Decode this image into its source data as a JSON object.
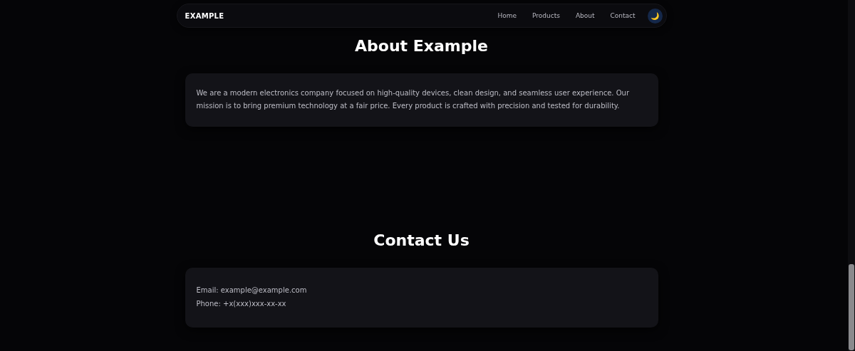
{
  "navbar": {
    "brand": "EXAMPLE",
    "links": [
      {
        "label": "Home"
      },
      {
        "label": "Products"
      },
      {
        "label": "About"
      },
      {
        "label": "Contact"
      }
    ],
    "theme_toggle": {
      "icon": "🌙"
    }
  },
  "sections": [
    {
      "title": "About Example",
      "kind": "paragraph",
      "lines": [
        "We are a modern electronics company focused on high-quality devices, clean design, and seamless user experience. Our mission is to bring premium technology at a fair price. Every product is crafted with precision and tested for durability."
      ]
    },
    {
      "title": "Contact Us",
      "kind": "list",
      "lines": [
        "Email: example@example.com",
        "Phone: +x(xxx)xxx-xx-xx"
      ]
    }
  ]
}
